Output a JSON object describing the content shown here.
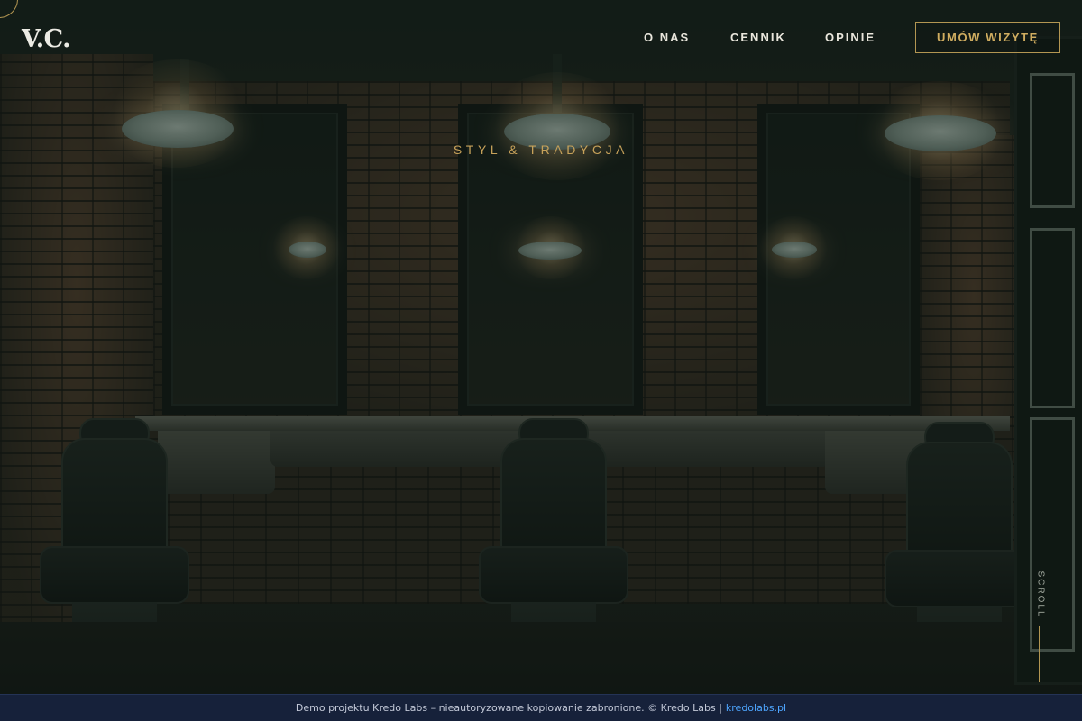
{
  "brand": {
    "logo_text": "V.C."
  },
  "nav": {
    "items": [
      {
        "label": "O NAS"
      },
      {
        "label": "CENNIK"
      },
      {
        "label": "OPINIE"
      }
    ],
    "cta_label": "UMÓW WIZYTĘ"
  },
  "hero": {
    "tagline": "STYL & TRADYCJA",
    "background_image": "barbershop-interior-photo"
  },
  "scroll": {
    "label": "SCROLL"
  },
  "notice": {
    "text": "Demo projektu Kredo Labs – nieautoryzowane kopiowanie zabronione. © Kredo Labs |",
    "link_text": "kredolabs.pl"
  },
  "colors": {
    "accent_gold": "#c7a25a",
    "nav_text": "#e9e6dc",
    "notice_bg": "#16213a",
    "notice_link": "#4ea6ff"
  }
}
